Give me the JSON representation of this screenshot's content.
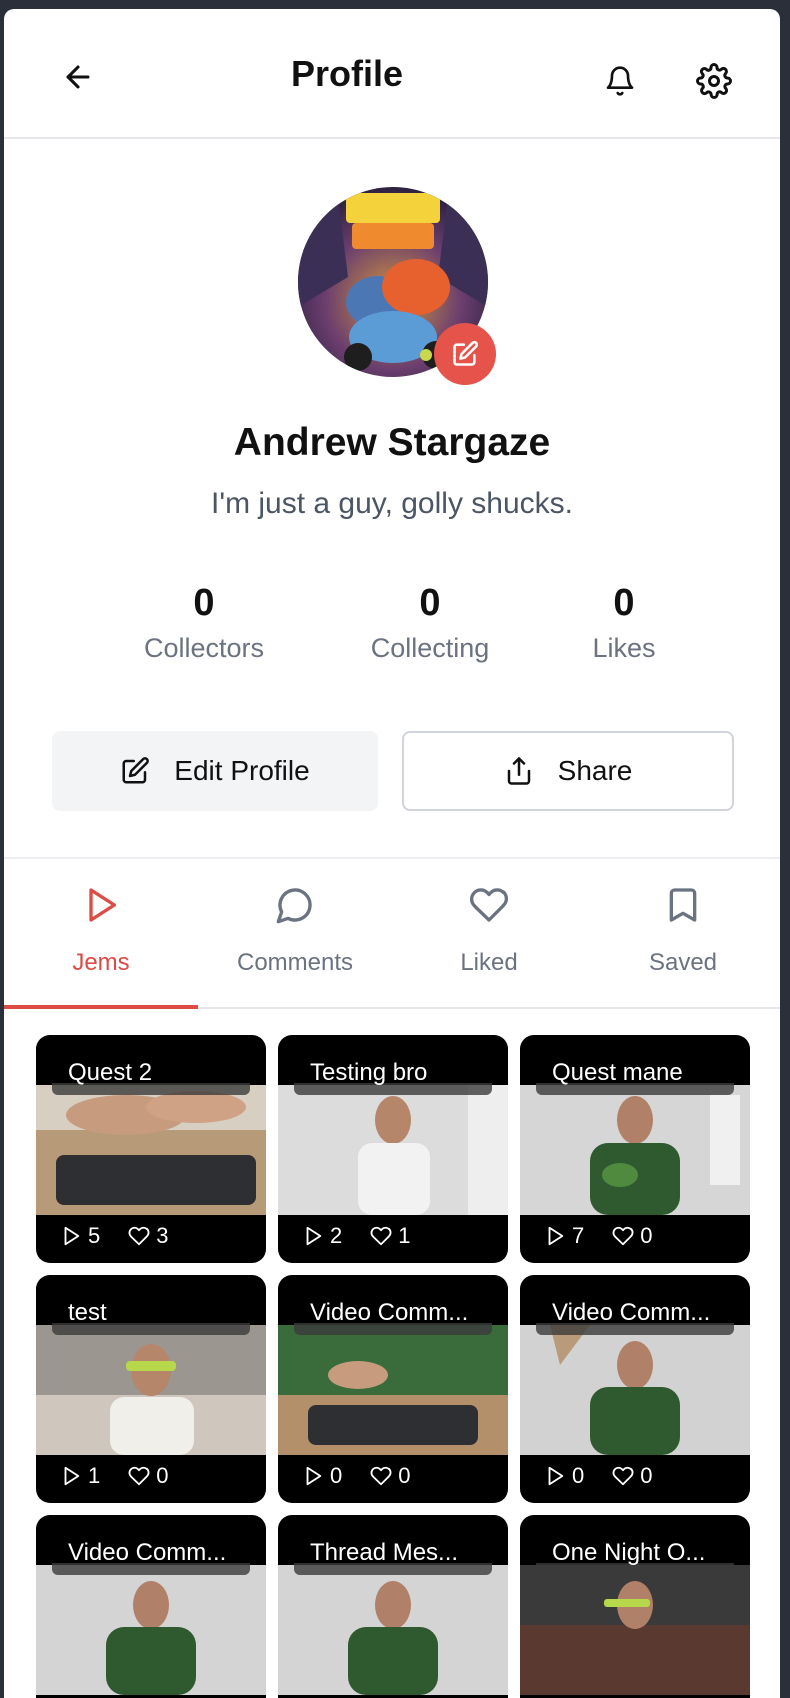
{
  "header": {
    "title": "Profile"
  },
  "profile": {
    "name": "Andrew Stargaze",
    "bio": "I'm just a guy, golly shucks."
  },
  "stats": [
    {
      "value": "0",
      "label": "Collectors"
    },
    {
      "value": "0",
      "label": "Collecting"
    },
    {
      "value": "0",
      "label": "Likes"
    }
  ],
  "actions": {
    "edit_label": "Edit Profile",
    "share_label": "Share"
  },
  "tabs": [
    {
      "label": "Jems",
      "icon": "play-icon",
      "active": true
    },
    {
      "label": "Comments",
      "icon": "comment-icon",
      "active": false
    },
    {
      "label": "Liked",
      "icon": "heart-icon",
      "active": false
    },
    {
      "label": "Saved",
      "icon": "bookmark-icon",
      "active": false
    }
  ],
  "jems": [
    {
      "title": "Quest 2",
      "plays": "5",
      "likes": "3"
    },
    {
      "title": "Testing bro",
      "plays": "2",
      "likes": "1"
    },
    {
      "title": "Quest mane",
      "plays": "7",
      "likes": "0"
    },
    {
      "title": "test",
      "plays": "1",
      "likes": "0"
    },
    {
      "title": "Video Comm...",
      "plays": "0",
      "likes": "0"
    },
    {
      "title": "Video Comm...",
      "plays": "0",
      "likes": "0"
    },
    {
      "title": "Video Comm...",
      "plays": "",
      "likes": ""
    },
    {
      "title": "Thread Mes...",
      "plays": "",
      "likes": ""
    },
    {
      "title": "One Night O...",
      "plays": "",
      "likes": ""
    }
  ],
  "colors": {
    "accent": "#dc4c45",
    "muted": "#6b7280"
  }
}
